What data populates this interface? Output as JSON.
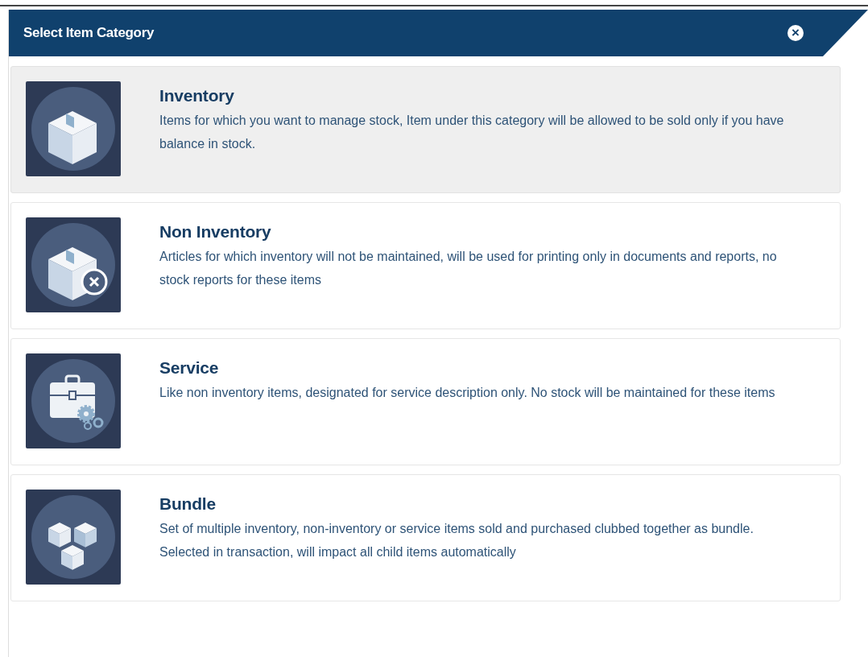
{
  "dialog": {
    "title": "Select Item Category",
    "close_icon": "×"
  },
  "categories": [
    {
      "kind": "box",
      "title": "Inventory",
      "description": "Items for which you want to manage stock, Item under this category will be allowed to be sold only if you have balance in stock.",
      "selected": true
    },
    {
      "kind": "box-x",
      "title": "Non Inventory",
      "description": "Articles for which inventory will not be maintained, will be used for printing only in documents and reports, no stock reports for these items",
      "selected": false
    },
    {
      "kind": "briefcase",
      "title": "Service",
      "description": "Like non inventory items, designated for service description only. No stock will be maintained for these items",
      "selected": false
    },
    {
      "kind": "bundle",
      "title": "Bundle",
      "description": "Set of multiple inventory, non-inventory or service items sold and purchased clubbed together as bundle. Selected in transaction, will impact all child items automatically",
      "selected": false
    }
  ]
}
